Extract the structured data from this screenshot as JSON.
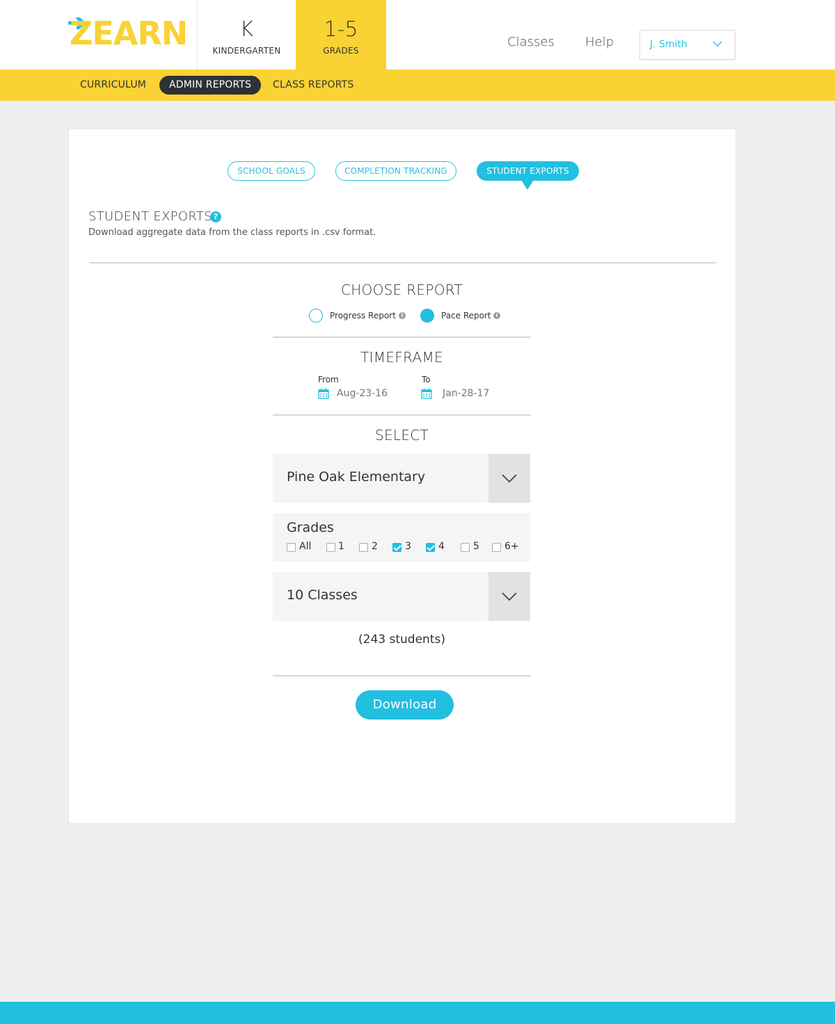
{
  "header": {
    "logo_text": "ZEARN",
    "grade_k": {
      "big": "K",
      "small": "KINDERGARTEN"
    },
    "grade_15": {
      "big": "1-5",
      "small": "GRADES"
    },
    "nav": {
      "classes": "Classes",
      "help": "Help"
    },
    "user": {
      "name": "J. Smith"
    }
  },
  "subnav": {
    "curriculum": "CURRICULUM",
    "admin_reports": "ADMIN REPORTS",
    "class_reports": "CLASS REPORTS"
  },
  "tabs": {
    "school_goals": "SCHOOL GOALS",
    "completion_tracking": "COMPLETION TRACKING",
    "student_exports": "STUDENT EXPORTS"
  },
  "section": {
    "title": "STUDENT EXPORTS",
    "help_glyph": "?",
    "description": "Download aggregate data from the class reports in .csv format."
  },
  "choose_report": {
    "title": "CHOOSE REPORT",
    "options": [
      {
        "label": "Progress Report",
        "selected": false
      },
      {
        "label": "Pace Report",
        "selected": true
      }
    ],
    "info_glyph": "i"
  },
  "timeframe": {
    "title": "TIMEFRAME",
    "from_label": "From",
    "from_value": "Aug-23-16",
    "to_label": "To",
    "to_value": "Jan-28-17"
  },
  "select": {
    "title": "SELECT",
    "school": "Pine Oak Elementary",
    "grades_title": "Grades",
    "grades": [
      {
        "label": "All",
        "checked": false
      },
      {
        "label": "1",
        "checked": false
      },
      {
        "label": "2",
        "checked": false
      },
      {
        "label": "3",
        "checked": true
      },
      {
        "label": "4",
        "checked": true
      },
      {
        "label": "5",
        "checked": false
      },
      {
        "label": "6+",
        "checked": false
      }
    ],
    "classes": "10 Classes",
    "student_count": "(243 students)"
  },
  "download_label": "Download",
  "colors": {
    "brand_yellow": "#f9d234",
    "accent_blue": "#22bfe0",
    "dark_pill": "#2e3236"
  },
  "icons": {
    "logo_arrow": "arrow-right-icon",
    "user_chevron": "chevron-down-icon",
    "help": "question-circle-icon",
    "info": "info-circle-icon",
    "calendar": "calendar-icon",
    "dropdown": "chevron-down-icon"
  }
}
